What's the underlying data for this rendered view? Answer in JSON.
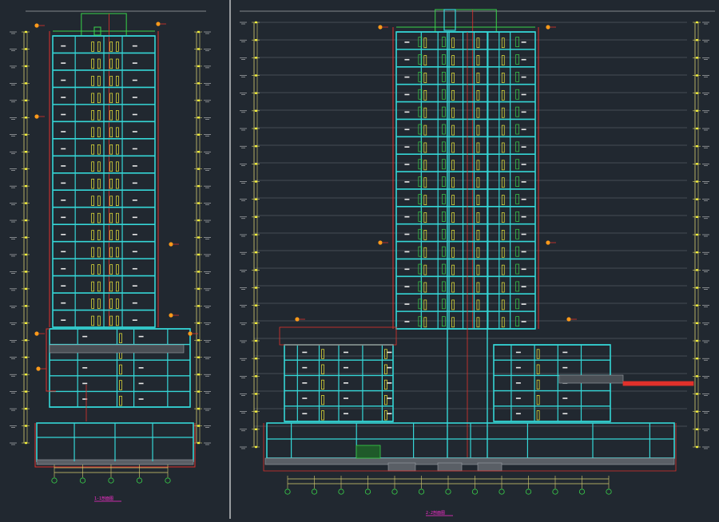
{
  "drawing": {
    "background": "#212830",
    "colors": {
      "wall": "#35d6d6",
      "outline": "#e0312b",
      "window": "#f3ef3a",
      "green": "#39d44a",
      "white": "#e8e8e8",
      "gray": "#9aa0a6",
      "magenta": "#ff2fd2",
      "orange": "#ff9a1a",
      "dim": "#d8d070"
    },
    "left_section": {
      "title": "1-1剖面图",
      "tower_floors": 17,
      "podium_floors": 5,
      "axis_count": 5
    },
    "right_section": {
      "title": "2-2剖面图",
      "tower_floors": 17,
      "podium_floors": 5,
      "axis_count": 13
    }
  }
}
